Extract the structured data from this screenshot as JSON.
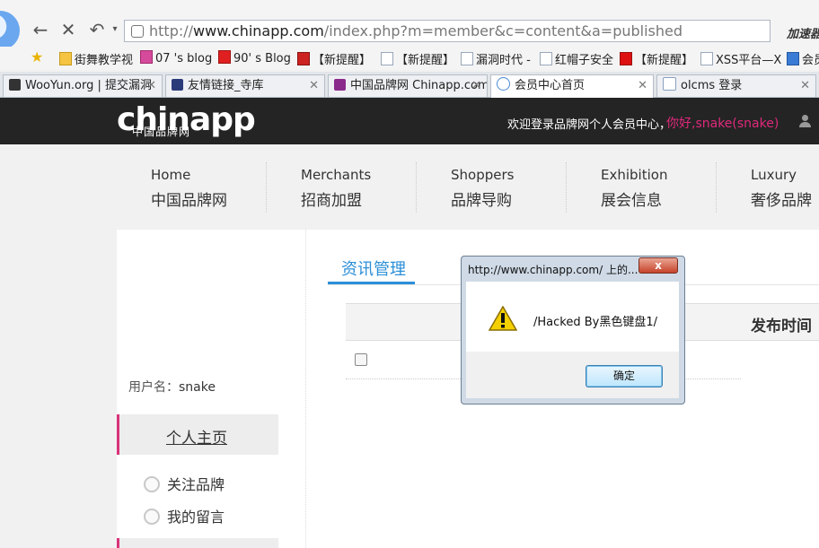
{
  "browser": {
    "url_scheme": "http://",
    "url_host": "www.chinapp.com",
    "url_path": "/index.php?m=member&c=content&a=published",
    "accelerate_label": "加速器",
    "favorites": [
      "街舞教学视",
      "07 's blog",
      "90' s Blog",
      "【新提醒】",
      "【新提醒】",
      "漏洞时代 -",
      "红帽子安全",
      "【新提醒】",
      "XSS平台—X",
      "会员"
    ],
    "tabs": [
      {
        "title": "WooYun.org | 提交漏洞"
      },
      {
        "title": "友情链接_寺库"
      },
      {
        "title": "中国品牌网 Chinapp.com"
      },
      {
        "title": "会员中心首页"
      },
      {
        "title": "olcms 登录"
      }
    ]
  },
  "site": {
    "logo": "chinapp",
    "logo_sub": "中国品牌网",
    "welcome": "欢迎登录品牌网个人会员中心，",
    "user_greeting": "你好,snake(snake)",
    "nav": [
      {
        "en": "Home",
        "cn": "中国品牌网"
      },
      {
        "en": "Merchants",
        "cn": "招商加盟"
      },
      {
        "en": "Shoppers",
        "cn": "品牌导购"
      },
      {
        "en": "Exhibition",
        "cn": "展会信息"
      },
      {
        "en": "Luxury",
        "cn": "奢侈品牌"
      }
    ]
  },
  "sidebar": {
    "username_label": "用户名：",
    "username": "snake",
    "home": "个人主页",
    "items": [
      "关注品牌",
      "我的留言"
    ]
  },
  "content": {
    "tab": "资讯管理",
    "col_publish_time": "发布时间"
  },
  "dialog": {
    "title": "http://www.chinapp.com/ 上的...",
    "close": "x",
    "message": "/Hacked By黑色键盘1/",
    "ok": "确定"
  }
}
